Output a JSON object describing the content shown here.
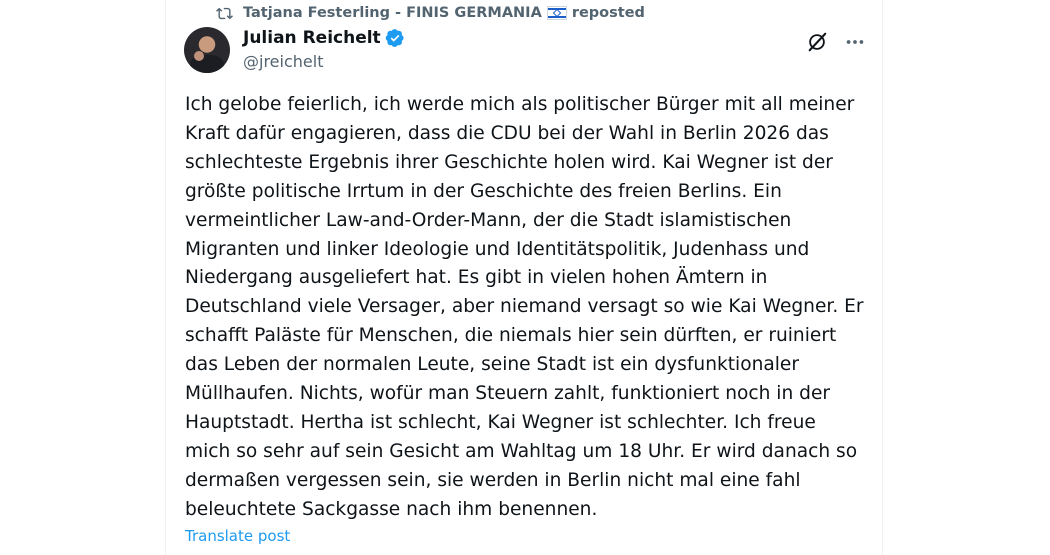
{
  "repost": {
    "reposter_name": "Tatjana Festerling - FINIS GERMANIA",
    "label": "reposted",
    "icon": "repost-icon",
    "flag_icon": "israel-flag-icon"
  },
  "author": {
    "name": "Julian Reichelt",
    "handle": "@jreichelt",
    "verified": true,
    "verified_color": "#1d9bf0"
  },
  "actions": {
    "grok_icon": "grok-icon",
    "more_icon": "more-icon"
  },
  "post": {
    "text": "Ich gelobe feierlich, ich werde mich als politischer Bürger mit all meiner\nKraft dafür engagieren, dass die CDU bei der Wahl in Berlin 2026 das\nschlechteste Ergebnis ihrer Geschichte holen wird. Kai Wegner ist der\ngrößte politische Irrtum in der Geschichte des freien Berlins. Ein\nvermeintlicher Law-and-Order-Mann, der die Stadt islamistischen\nMigranten und linker Ideologie und Identitätspolitik, Judenhass und\nNiedergang ausgeliefert hat. Es gibt in vielen hohen Ämtern in\nDeutschland viele Versager, aber niemand versagt so wie Kai Wegner. Er\nschafft Paläste für Menschen, die niemals hier sein dürften, er ruiniert\ndas Leben der normalen Leute, seine Stadt ist ein dysfunktionaler\nMüllhaufen. Nichts, wofür man Steuern zahlt, funktioniert noch in der\nHauptstadt. Hertha ist schlecht, Kai Wegner ist schlechter. Ich freue\nmich so sehr auf sein Gesicht am Wahltag um 18 Uhr. Er wird danach so\ndermaßen vergessen sein, sie werden in Berlin nicht mal eine fahl\nbeleuchtete Sackgasse nach ihm benennen.",
    "translate_label": "Translate post"
  },
  "colors": {
    "text_primary": "#0f1419",
    "text_secondary": "#536471",
    "link": "#1d9bf0",
    "border": "#eff3f4"
  }
}
